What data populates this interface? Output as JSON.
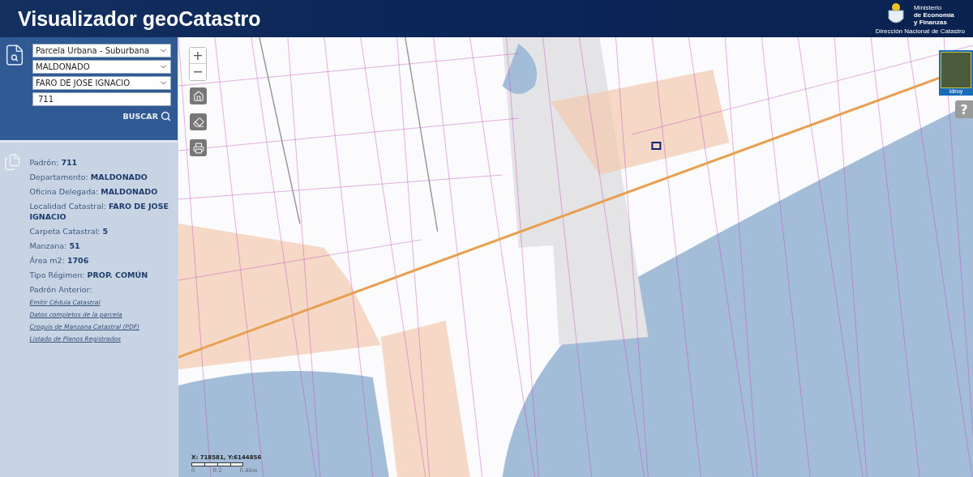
{
  "header": {
    "title": "Visualizador geoCatastro",
    "ministry_lines": [
      {
        "text": "Ministerio",
        "bold": false
      },
      {
        "text": "de Economía",
        "bold": true
      },
      {
        "text": "y Finanzas",
        "bold": true
      }
    ],
    "agency": "Dirección Nacional de Catastro"
  },
  "search": {
    "selects": [
      "Parcela Urbana - Suburbana",
      "MALDONADO",
      "FARO DE JOSE IGNACIO"
    ],
    "input": "711",
    "button": "BUSCAR"
  },
  "info": {
    "fields": [
      {
        "label": "Padrón:",
        "value": "711"
      },
      {
        "label": "Departamento:",
        "value": "MALDONADO"
      },
      {
        "label": "Oficina Delegada:",
        "value": "MALDONADO"
      },
      {
        "label": "Localidad Catastral:",
        "value": "FARO DE JOSE IGNACIO"
      },
      {
        "label": "Carpeta Catastral:",
        "value": "5"
      },
      {
        "label": "Manzana:",
        "value": "51"
      },
      {
        "label": "Área m2:",
        "value": "1706"
      },
      {
        "label": "Tipo Régimen:",
        "value": "PROP. COMÚN"
      },
      {
        "label": "Padrón Anterior:"
      }
    ],
    "links": [
      "Emitir Cédula Catastral",
      "Datos completos de la parcela",
      "Croquis de Manzana Catastral (PDF)",
      "Listado de Planos Registrados"
    ]
  },
  "map": {
    "zoom_in": "+",
    "zoom_out": "−",
    "coordinates": "X: 718581, Y:6144856",
    "scale_labels": [
      "0",
      "0.2",
      "0.4km"
    ],
    "basemap_label": "ideuy",
    "help": "?"
  }
}
